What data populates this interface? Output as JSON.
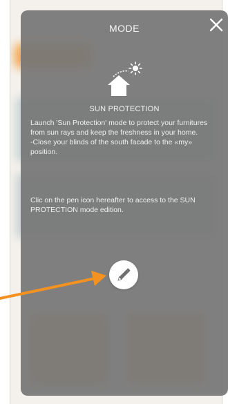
{
  "modal": {
    "title": "MODE",
    "close_icon": "close-icon",
    "mode_icon": "sun-house-icon",
    "section_title": "SUN PROTECTION",
    "description": "Launch 'Sun Protection' mode to protect your furnitures from sun rays and keep the freshness in your home.\n-Close your blinds of the south facade to the «my» position.",
    "instruction": "Clic on the pen icon hereafter to access to the SUN PROTECTION mode edition.",
    "edit_icon": "pen-icon"
  },
  "annotation": {
    "arrow_color": "#F39221",
    "arrow_icon": "arrow-icon"
  },
  "colors": {
    "overlay": "#767676",
    "text": "#FFFFFF"
  }
}
